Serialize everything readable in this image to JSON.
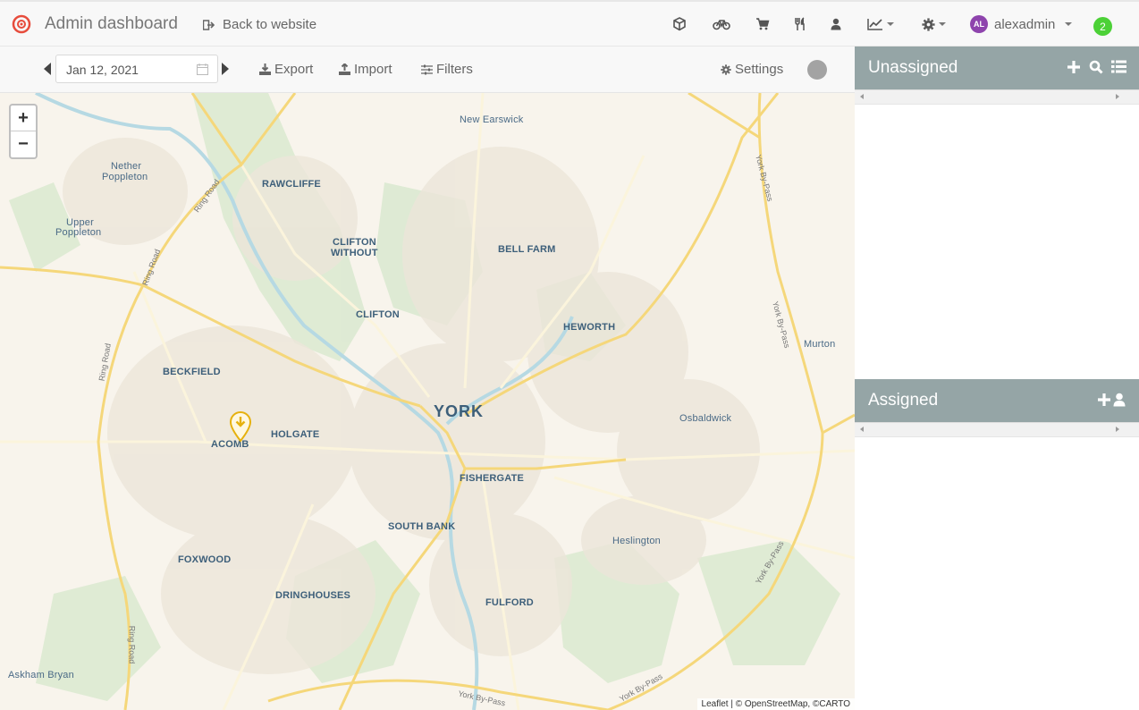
{
  "navbar": {
    "title": "Admin dashboard",
    "back_label": "Back to website",
    "icons": [
      "cube-icon",
      "bike-icon",
      "cart-icon",
      "restaurant-icon",
      "user-icon",
      "chart-icon",
      "gear-icon"
    ],
    "user": {
      "initials": "AL",
      "name": "alexadmin"
    },
    "notifications": "2"
  },
  "toolbar": {
    "date": "Jan 12, 2021",
    "export_label": "Export",
    "import_label": "Import",
    "filters_label": "Filters",
    "settings_label": "Settings"
  },
  "map": {
    "zoom_in": "+",
    "zoom_out": "−",
    "labels": {
      "new_earswick": "New Earswick",
      "nether_poppleton_1": "Nether",
      "nether_poppleton_2": "Poppleton",
      "rawcliffe": "RAWCLIFFE",
      "upper_poppleton_1": "Upper",
      "upper_poppleton_2": "Poppleton",
      "clifton_without_1": "CLIFTON",
      "clifton_without_2": "WITHOUT",
      "bell_farm": "BELL FARM",
      "clifton": "CLIFTON",
      "heworth": "HEWORTH",
      "murton": "Murton",
      "beckfield": "BECKFIELD",
      "york": "YORK",
      "osbaldwick": "Osbaldwick",
      "holgate": "HOLGATE",
      "acomb": "ACOMB",
      "fishergate": "FISHERGATE",
      "south_bank": "SOUTH BANK",
      "heslington": "Heslington",
      "foxwood": "FOXWOOD",
      "dringhouses": "DRINGHOUSES",
      "fulford": "FULFORD",
      "askham_bryan": "Askham Bryan"
    },
    "roads": {
      "ring_road": "Ring Road",
      "york_bypass": "York By-Pass"
    },
    "attribution": "Leaflet | © OpenStreetMap, ©CARTO"
  },
  "panels": {
    "unassigned_title": "Unassigned",
    "assigned_title": "Assigned"
  },
  "colors": {
    "panel_header": "#95a5a6",
    "marker": "#e6b10e",
    "badge": "#4cd137",
    "avatar": "#8e44ad"
  }
}
